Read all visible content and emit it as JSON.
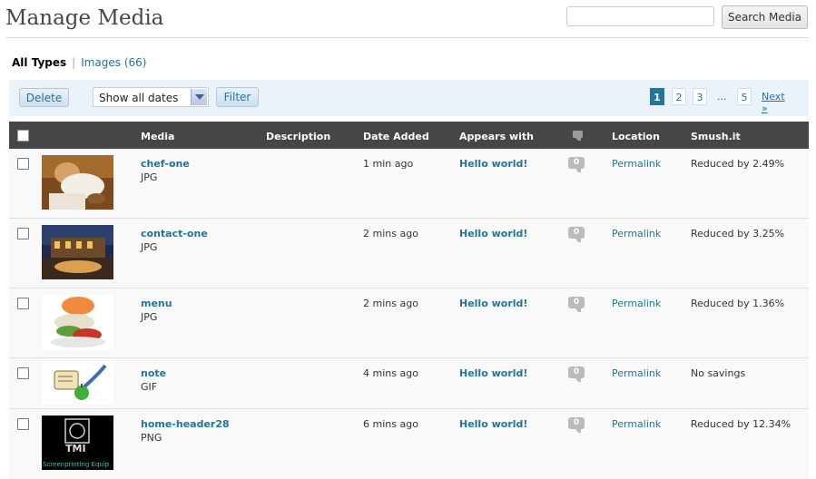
{
  "header": {
    "title": "Manage Media",
    "search_placeholder": "",
    "search_button": "Search Media"
  },
  "filters": {
    "all_types": "All Types",
    "separator": "|",
    "images": "Images (66)"
  },
  "toolbar": {
    "delete_label": "Delete",
    "dates_selected": "Show all dates",
    "filter_label": "Filter"
  },
  "pagination": {
    "pages": [
      "1",
      "2",
      "3"
    ],
    "current": "1",
    "dots": "...",
    "last": "5",
    "next": "Next »"
  },
  "table": {
    "headers": {
      "media": "Media",
      "description": "Description",
      "date_added": "Date Added",
      "appears_with": "Appears with",
      "location": "Location",
      "smush": "Smush.it"
    },
    "rows": [
      {
        "name": "chef-one",
        "ext": "JPG",
        "date": "1 min ago",
        "appears": "Hello world!",
        "comments": "0",
        "location": "Permalink",
        "smush": "Reduced by 2.49%",
        "thumb_icon": "chef-photo"
      },
      {
        "name": "contact-one",
        "ext": "JPG",
        "date": "2 mins ago",
        "appears": "Hello world!",
        "comments": "0",
        "location": "Permalink",
        "smush": "Reduced by 3.25%",
        "thumb_icon": "restaurant-night-photo"
      },
      {
        "name": "menu",
        "ext": "JPG",
        "date": "2 mins ago",
        "appears": "Hello world!",
        "comments": "0",
        "location": "Permalink",
        "smush": "Reduced by 1.36%",
        "thumb_icon": "food-dish-photo"
      },
      {
        "name": "note",
        "ext": "GIF",
        "date": "4 mins ago",
        "appears": "Hello world!",
        "comments": "0",
        "location": "Permalink",
        "smush": "No savings",
        "thumb_icon": "scroll-quill-apple"
      },
      {
        "name": "home-header28",
        "ext": "PNG",
        "date": "6 mins ago",
        "appears": "Hello world!",
        "comments": "0",
        "location": "Permalink",
        "smush": "Reduced by 12.34%",
        "thumb_icon": "tmi-logo",
        "thumb_text": "TMI",
        "thumb_caption": "Screenprinting Equip"
      }
    ]
  },
  "colors": {
    "link": "#21759b",
    "header_bg": "#464646",
    "nav_bg": "#eaf2fa"
  }
}
